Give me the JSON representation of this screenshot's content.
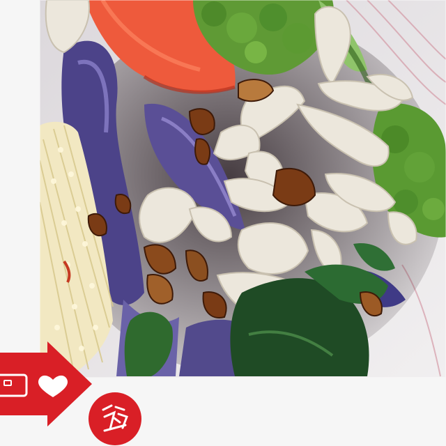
{
  "photo": {
    "subject": "salad-plate",
    "colors": {
      "background": "#f4f4f4",
      "plate": "#e9e6e8",
      "plate_stripe": "#d49aa6",
      "tomato": "#ee5a3c",
      "broccoli": "#5f9a35",
      "cabbage": "#5a4f96",
      "mushroom": "#ece7dc",
      "baby_corn": "#f2e8c2",
      "greens": "#1f4b25",
      "sauce": "#5a2a12"
    }
  },
  "sticker": {
    "color": "#d91f26",
    "icons": [
      "arrow-icon",
      "camera-icon",
      "heart-icon",
      "stamp-icon"
    ]
  }
}
